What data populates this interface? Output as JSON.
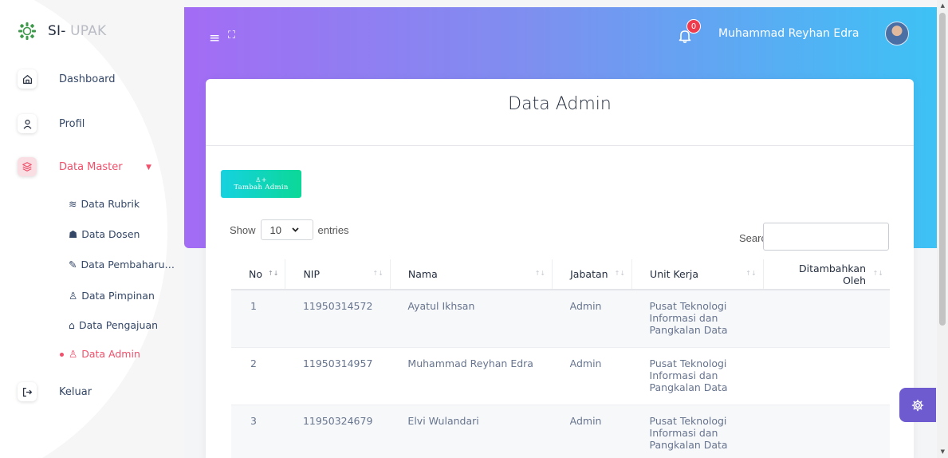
{
  "brand": {
    "prefix": "SI-",
    "accent": "UPAK"
  },
  "sidebar": {
    "items": [
      {
        "label": "Dashboard"
      },
      {
        "label": "Profil"
      },
      {
        "label": "Data Master"
      },
      {
        "label": "Keluar"
      }
    ],
    "subitems": [
      {
        "label": "Data Rubrik",
        "icon": "layers-icon"
      },
      {
        "label": "Data Dosen",
        "icon": "graduation-icon"
      },
      {
        "label": "Data Pembaharu…",
        "icon": "edit-icon"
      },
      {
        "label": "Data Pimpinan",
        "icon": "users-icon"
      },
      {
        "label": "Data Pengajuan",
        "icon": "inbox-icon"
      },
      {
        "label": "Data Admin",
        "icon": "add-user-icon"
      }
    ]
  },
  "header": {
    "notification_count": "0",
    "username": "Muhammad Reyhan Edra"
  },
  "card": {
    "title": "Data Admin",
    "add_button_label": "Tambah Admin",
    "show_label": "Show",
    "entries_value": "10",
    "entries_label": "entries",
    "search_label": "Search:",
    "search_value": ""
  },
  "table": {
    "columns": [
      "No",
      "NIP",
      "Nama",
      "Jabatan",
      "Unit Kerja",
      "Ditambahkan Oleh"
    ],
    "rows": [
      [
        "1",
        "11950314572",
        "Ayatul Ikhsan",
        "Admin",
        "Pusat Teknologi Informasi dan Pangkalan Data",
        ""
      ],
      [
        "2",
        "11950314957",
        "Muhammad Reyhan Edra",
        "Admin",
        "Pusat Teknologi Informasi dan Pangkalan Data",
        ""
      ],
      [
        "3",
        "11950324679",
        "Elvi Wulandari",
        "Admin",
        "Pusat Teknologi Informasi dan Pangkalan Data",
        ""
      ]
    ]
  },
  "colors": {
    "accent": "#f14f6a",
    "gradient_start": "#a36cf4",
    "gradient_end": "#3dc2f5",
    "button_start": "#16d2e0",
    "button_end": "#0bd897",
    "fab": "#6f5bd0"
  }
}
